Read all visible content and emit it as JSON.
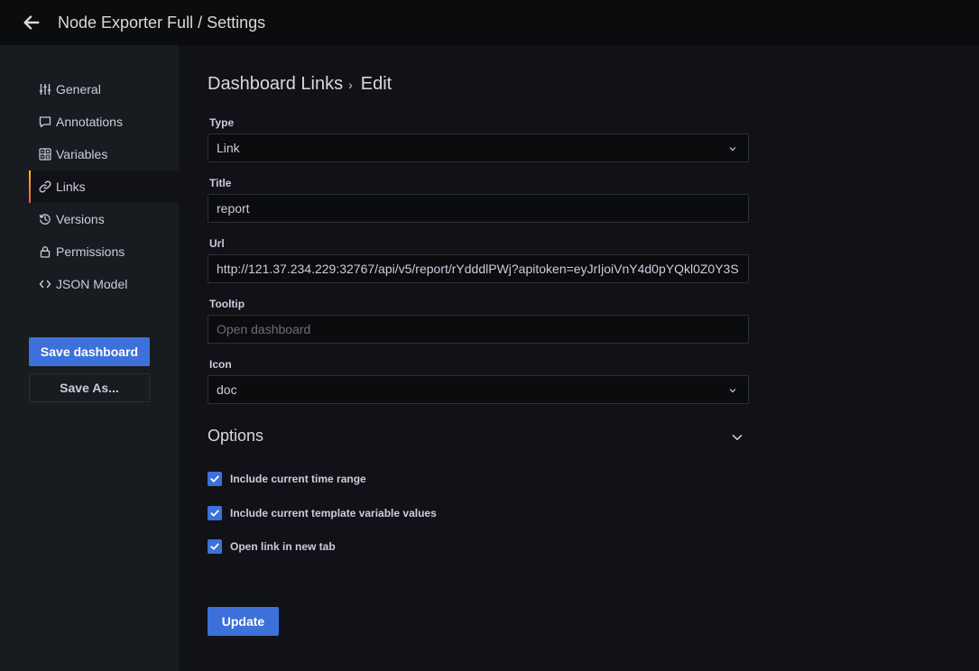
{
  "header": {
    "title": "Node Exporter Full / Settings",
    "back_icon": "arrow-left-icon"
  },
  "sidebar": {
    "items": [
      {
        "label": "General",
        "icon": "sliders-icon"
      },
      {
        "label": "Annotations",
        "icon": "comment-icon"
      },
      {
        "label": "Variables",
        "icon": "calculator-icon"
      },
      {
        "label": "Links",
        "icon": "link-icon",
        "active": true
      },
      {
        "label": "Versions",
        "icon": "history-icon"
      },
      {
        "label": "Permissions",
        "icon": "lock-icon"
      },
      {
        "label": "JSON Model",
        "icon": "code-icon"
      }
    ],
    "save_label": "Save dashboard",
    "save_as_label": "Save As..."
  },
  "main": {
    "breadcrumb": {
      "section": "Dashboard Links",
      "separator": "›",
      "current": "Edit"
    },
    "form": {
      "type_label": "Type",
      "type_value": "Link",
      "title_label": "Title",
      "title_value": "report",
      "url_label": "Url",
      "url_value": "http://121.37.234.229:32767/api/v5/report/rYdddlPWj?apitoken=eyJrIjoiVnY4d0pYQkl0Z0Y3S",
      "tooltip_label": "Tooltip",
      "tooltip_value": "",
      "tooltip_placeholder": "Open dashboard",
      "icon_label": "Icon",
      "icon_value": "doc"
    },
    "options": {
      "title": "Options",
      "checkboxes": [
        {
          "label": "Include current time range",
          "checked": true
        },
        {
          "label": "Include current template variable values",
          "checked": true
        },
        {
          "label": "Open link in new tab",
          "checked": true
        }
      ]
    },
    "update_label": "Update"
  },
  "colors": {
    "primary": "#3d71d9",
    "background": "#111217",
    "sidebar": "#181b1f",
    "topbar": "#0b0c0e"
  }
}
